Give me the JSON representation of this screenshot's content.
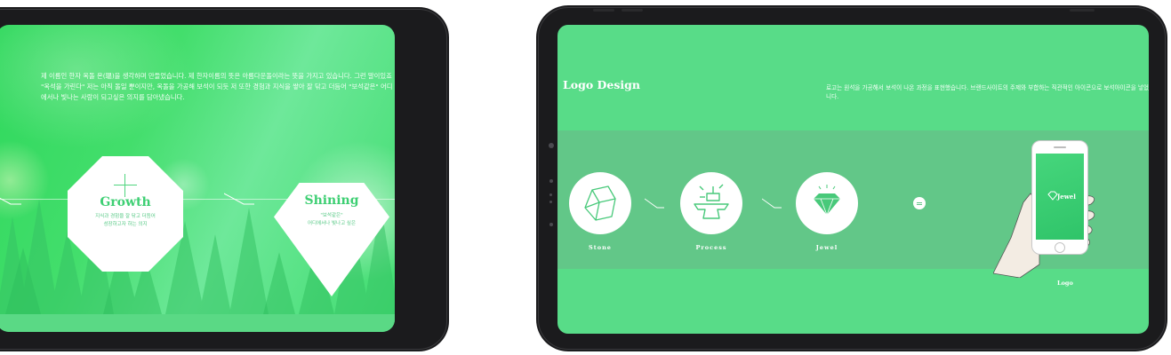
{
  "left_slide": {
    "description": "제 이름인 한자 옥돌 온(瑥)을 생각하며 만들었습니다. 제 한자이름의 뜻은 아름다운돌이라는 뜻을 가지고 있습니다. 그런 말이있죠 \"옥석을 가린다\" 저는 아직 돌일 뿐이지만, 옥돌을 가공해 보석이 되듯 저 또한 경험과 지식을 쌓아 잘 닦고 더듬어 \"보석같은\" 어디에서나 빛나는 사람이 되고싶은 의지를 담아냈습니다.",
    "growth": {
      "title": "Growth",
      "subtitle_line1": "지식과 경험을 잘 닦고 더듬어",
      "subtitle_line2": "성장하고자 하는 의지"
    },
    "shining": {
      "title": "Shining",
      "subtitle_line1": "\"보석같은\"",
      "subtitle_line2": "어디에서나 빛나고 싶은"
    }
  },
  "right_slide": {
    "title": "Logo Design",
    "description": "로고는 원석을 가공해서 보석이 나온 과정을 표현했습니다. 브랜드사이트의 주제와 부합하는 직관적인 아이콘으로 보석아이콘을 넣었습니다.",
    "steps": [
      {
        "label": "Stone",
        "icon": "stone-icon"
      },
      {
        "label": "Process",
        "icon": "anvil-hammer-icon"
      },
      {
        "label": "Jewel",
        "icon": "diamond-icon"
      }
    ],
    "phone_brand": "Jewel",
    "caption": "Logo"
  },
  "colors": {
    "green_primary": "#58dc88",
    "green_band": "#62c788",
    "green_accent": "#3ecf73",
    "bezel": "#1b1b1d"
  }
}
